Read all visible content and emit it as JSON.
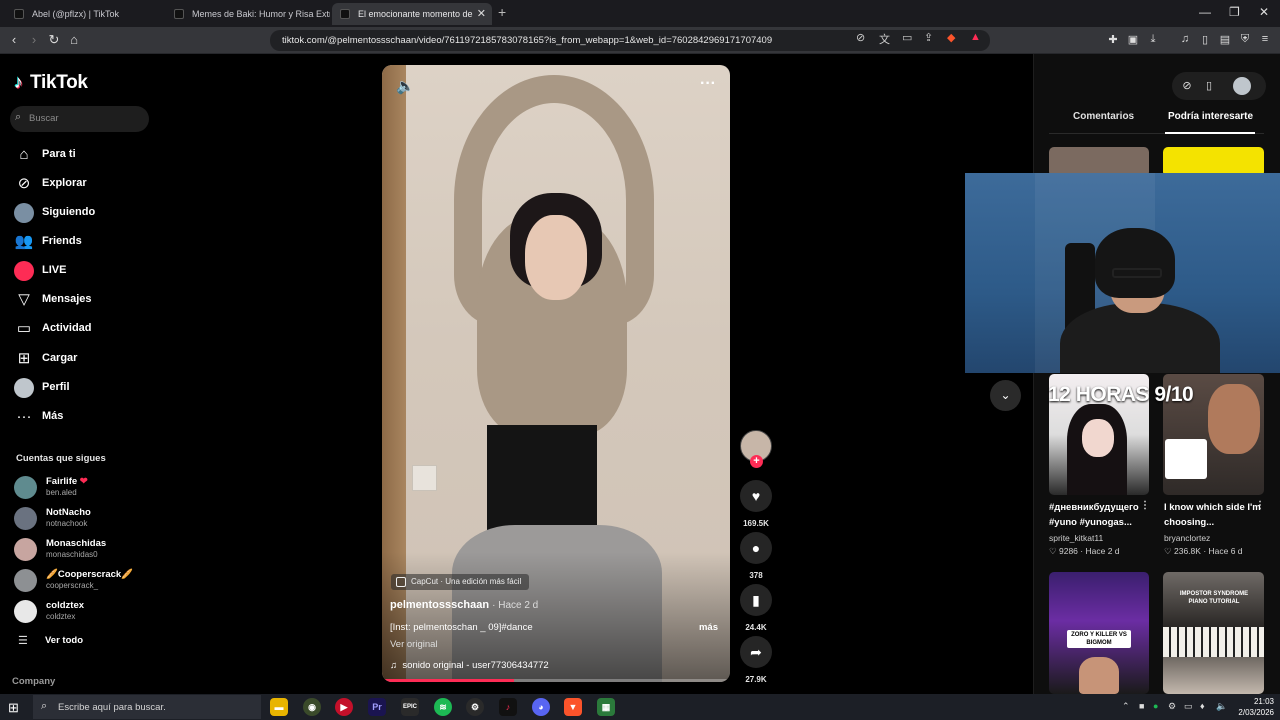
{
  "browser": {
    "tabs": [
      {
        "title": "Abel (@pflzx) | TikTok",
        "active": false
      },
      {
        "title": "Memes de Baki: Humor y Risa Extrem",
        "active": false
      },
      {
        "title": "El emocionante momento de",
        "active": true
      }
    ],
    "new_tab_symbol": "+",
    "url": "tiktok.com/@pelmentossschaan/video/7611972185783078165?is_from_webapp=1&web_id=7602842969171707409"
  },
  "sidebar": {
    "brand": "TikTok",
    "search_placeholder": "Buscar",
    "nav": [
      {
        "label": "Para ti",
        "icon": "home-icon"
      },
      {
        "label": "Explorar",
        "icon": "compass-icon"
      },
      {
        "label": "Siguiendo",
        "icon": "following-avatar-icon"
      },
      {
        "label": "Friends",
        "icon": "friends-icon"
      },
      {
        "label": "LIVE",
        "icon": "live-icon"
      },
      {
        "label": "Mensajes",
        "icon": "messages-icon"
      },
      {
        "label": "Actividad",
        "icon": "activity-icon"
      },
      {
        "label": "Cargar",
        "icon": "upload-icon"
      },
      {
        "label": "Perfil",
        "icon": "profile-icon"
      },
      {
        "label": "Más",
        "icon": "more-dots-icon"
      }
    ],
    "following_heading": "Cuentas que sigues",
    "following": [
      {
        "name": "Fairlife",
        "handle": "ben.aled",
        "badge": "❤"
      },
      {
        "name": "NotNacho",
        "handle": "notnachook"
      },
      {
        "name": "Monaschidas",
        "handle": "monaschidas0"
      },
      {
        "name": "🥖Cooperscrack🥖",
        "handle": "cooperscrack_"
      },
      {
        "name": "coldztex",
        "handle": "coldztex"
      }
    ],
    "see_all": "Ver todo",
    "company": "Company"
  },
  "video": {
    "capcut_label": "CapCut · Una edición más fácil",
    "author": "pelmentossschaan",
    "posted": "· Hace 2 d",
    "caption": "[Inst: pelmentoschan _ 09]#dance",
    "more": "más",
    "see_original": "Ver original",
    "sound": "sonido original - user77306434772",
    "progress": 0.38
  },
  "actions": {
    "likes": "169.5K",
    "comments": "378",
    "saves": "24.4K",
    "shares": "27.9K"
  },
  "right_panel": {
    "tabs": [
      "Comentarios",
      "Podría interesarte"
    ],
    "active_tab": 1,
    "banner_text": "12 HORAS 9/10",
    "recommendations": [
      {
        "title": "#дневникбудущего #yuno #yunogas...",
        "user": "sprite_kitkat11",
        "likes": "9286",
        "ago": "Hace 2 d"
      },
      {
        "title": "I know which side I'm choosing...",
        "user": "bryanclortez",
        "likes": "236.8K",
        "ago": "Hace 6 d"
      },
      {
        "overlay": "ZORO Y KILLER VS BIGMOM"
      },
      {
        "overlay": "IMPOSTOR SYNDROME PIANO TUTORIAL"
      }
    ]
  },
  "taskbar": {
    "search_placeholder": "Escribe aquí para buscar.",
    "time": "21:03",
    "date": "2/03/2026"
  },
  "colors": {
    "accent": "#fe2c55",
    "background": "#000000",
    "panel": "#0e0e0e"
  }
}
